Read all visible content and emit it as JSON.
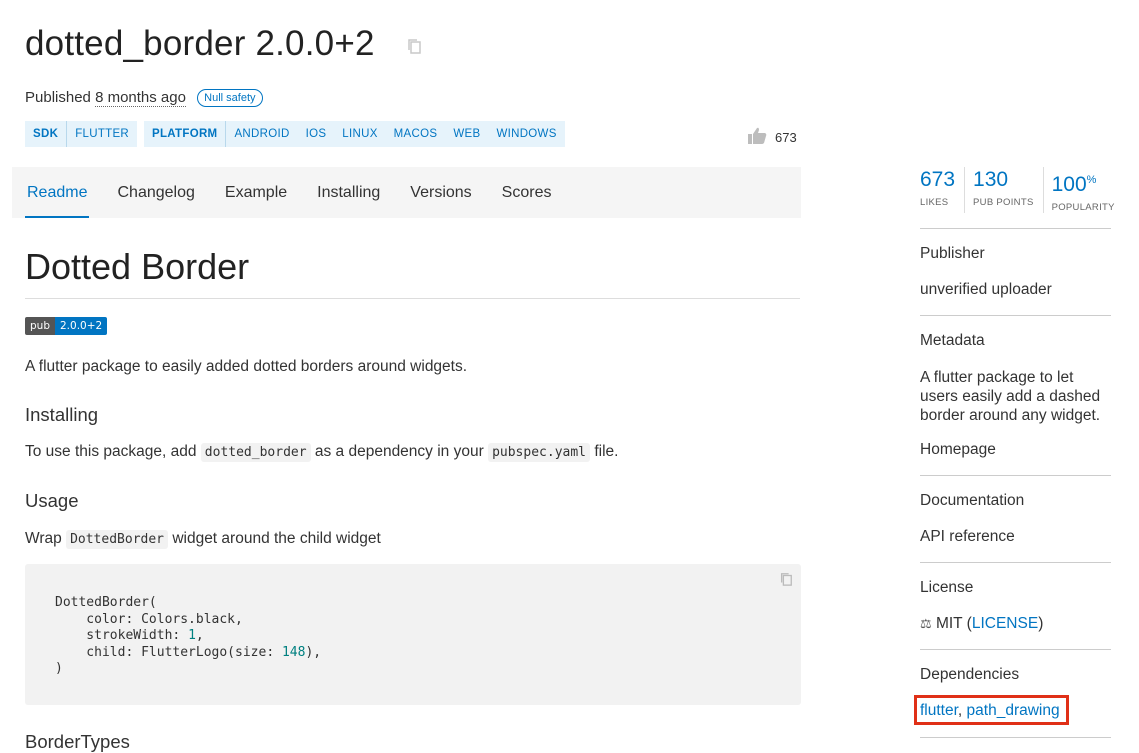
{
  "header": {
    "title": "dotted_border 2.0.0+2",
    "published_prefix": "Published",
    "published_ago": "8 months ago",
    "null_safety": "Null safety"
  },
  "tags": [
    {
      "head": "SDK",
      "items": [
        "FLUTTER"
      ]
    },
    {
      "head": "PLATFORM",
      "items": [
        "ANDROID",
        "IOS",
        "LINUX",
        "MACOS",
        "WEB",
        "WINDOWS"
      ]
    }
  ],
  "likes_count": "673",
  "tabs": [
    "Readme",
    "Changelog",
    "Example",
    "Installing",
    "Versions",
    "Scores"
  ],
  "readme": {
    "h1": "Dotted Border",
    "badge_left": "pub",
    "badge_right": "2.0.0+2",
    "intro": "A flutter package to easily added dotted borders around widgets.",
    "installing_heading": "Installing",
    "install_text_1": "To use this package, add",
    "install_code_1": "dotted_border",
    "install_text_2": "as a dependency in your",
    "install_code_2": "pubspec.yaml",
    "install_text_3": "file.",
    "usage_heading": "Usage",
    "usage_text_1": "Wrap",
    "usage_code": "DottedBorder",
    "usage_text_2": "widget around the child widget",
    "code_lines": {
      "l1": "DottedBorder(",
      "l2": "    color: Colors.black,",
      "l3a": "    strokeWidth: ",
      "l3b": "1",
      "l3c": ",",
      "l4a": "    child: FlutterLogo(size: ",
      "l4b": "148",
      "l4c": "),",
      "l5": ")"
    },
    "bordertypes_heading": "BorderTypes"
  },
  "sidebar": {
    "stats": [
      {
        "value": "673",
        "sup": "",
        "label": "LIKES"
      },
      {
        "value": "130",
        "sup": "",
        "label": "PUB POINTS"
      },
      {
        "value": "100",
        "sup": "%",
        "label": "POPULARITY"
      }
    ],
    "publisher_heading": "Publisher",
    "publisher_value": "unverified uploader",
    "metadata_heading": "Metadata",
    "metadata_text": "A flutter package to let users easily add a dashed border around any widget.",
    "homepage": "Homepage",
    "documentation_heading": "Documentation",
    "api_reference": "API reference",
    "license_heading": "License",
    "license_name": "MIT (",
    "license_link": "LICENSE",
    "license_close": ")",
    "dependencies_heading": "Dependencies",
    "dep_1": "flutter",
    "dep_sep": ", ",
    "dep_2": "path_drawing"
  },
  "colors": {
    "accent": "#0175c2",
    "highlight": "#e03017"
  }
}
